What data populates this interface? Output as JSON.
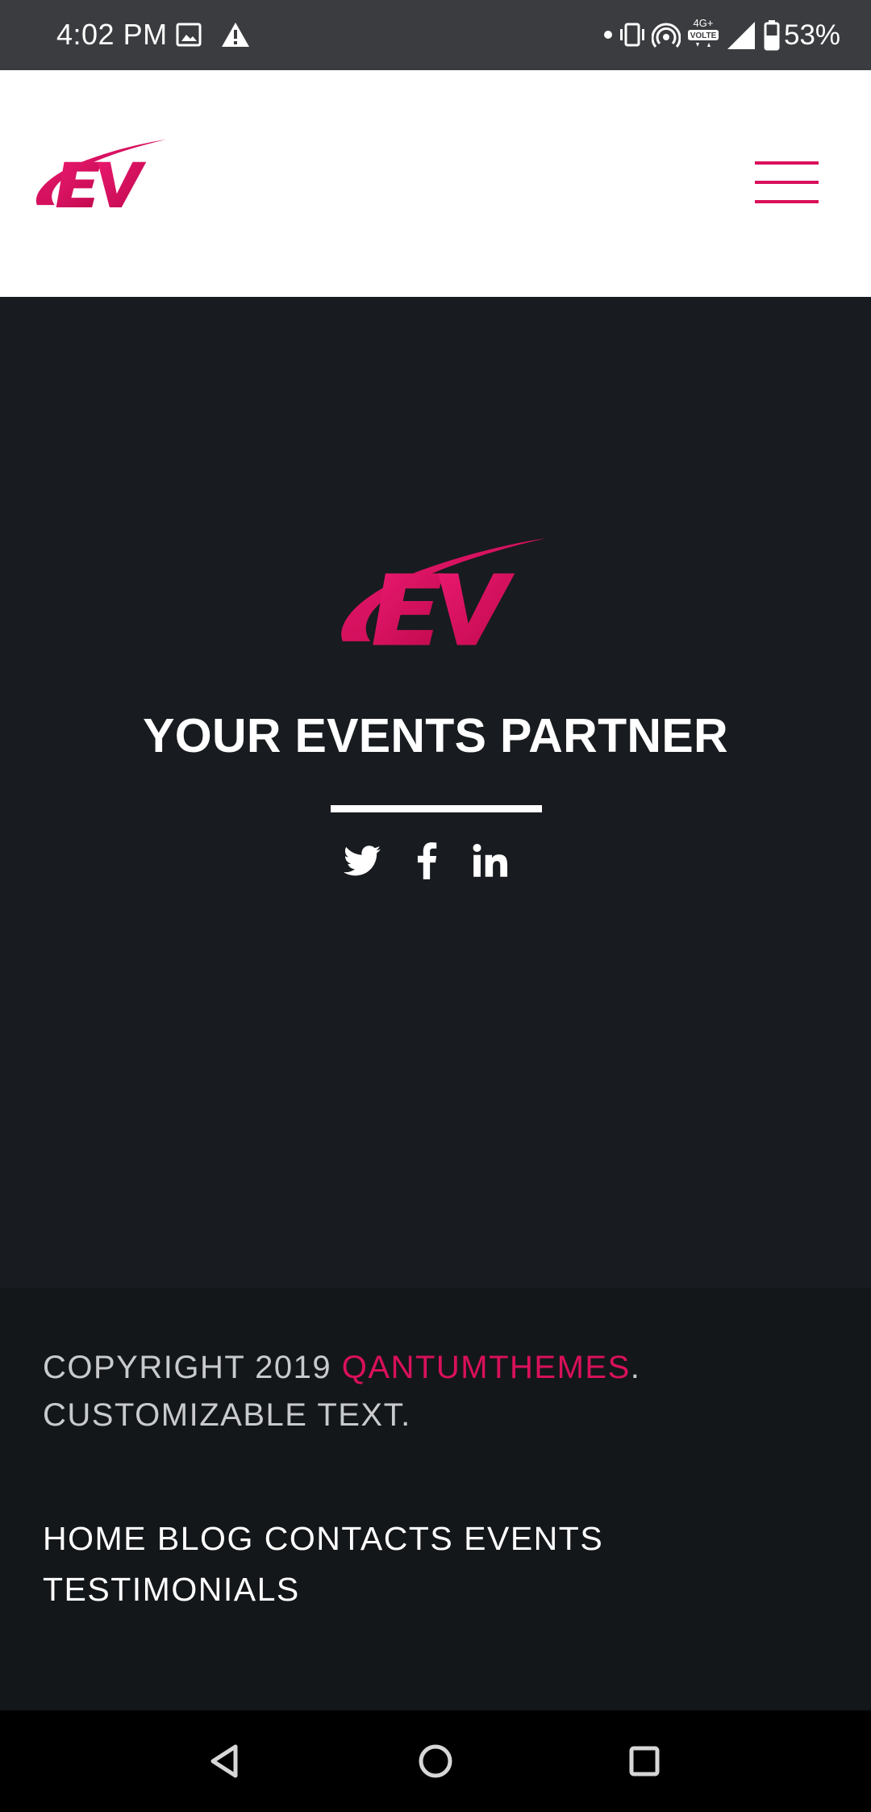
{
  "status_bar": {
    "time": "4:02 PM",
    "network": "4G+",
    "volte": "VOLTE",
    "battery": "53%",
    "icons": [
      "gallery-icon",
      "alert-icon",
      "dot-icon",
      "vibrate-icon",
      "hotspot-icon",
      "volte-icon",
      "signal-icon",
      "battery-icon"
    ]
  },
  "header": {
    "logo_text": "EV",
    "menu_icon": "hamburger-icon"
  },
  "hero": {
    "logo_text": "EV",
    "tagline": "YOUR EVENTS PARTNER",
    "social": [
      "twitter-icon",
      "facebook-icon",
      "linkedin-icon"
    ]
  },
  "footer": {
    "copyright_prefix": "COPYRIGHT 2019 ",
    "copyright_brand": "QANTUMTHEMES",
    "copyright_suffix": ". CUSTOMIZABLE TEXT.",
    "nav": [
      "HOME",
      "BLOG",
      "CONTACTS",
      "EVENTS",
      "TESTIMONIALS"
    ]
  },
  "colors": {
    "accent": "#d9105b",
    "hero_bg": "#181b1f",
    "footer_bg": "#14171a",
    "status_bar_bg": "#3b3c3f"
  },
  "system_nav": [
    "back-icon",
    "home-icon",
    "recents-icon"
  ]
}
